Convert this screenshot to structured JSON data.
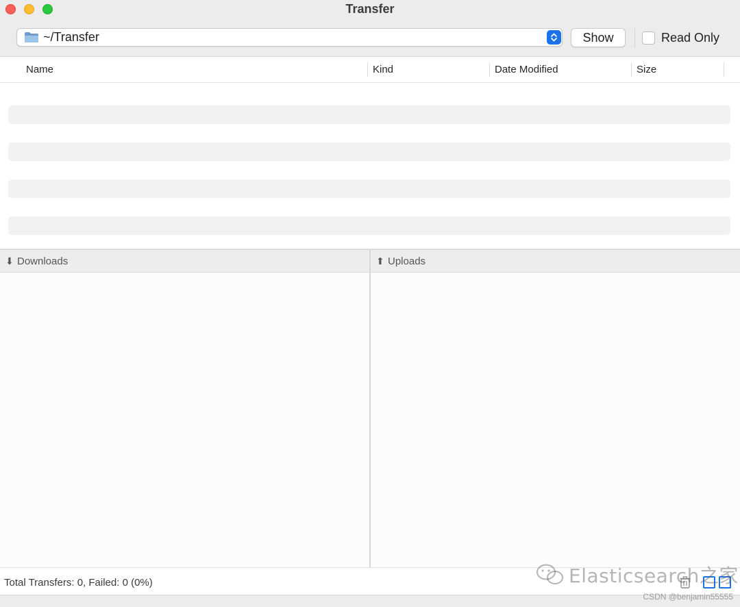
{
  "window": {
    "title": "Transfer"
  },
  "toolbar": {
    "path_value": "~/Transfer",
    "show_label": "Show",
    "read_only_label": "Read Only",
    "read_only_checked": false
  },
  "table": {
    "columns": [
      "Name",
      "Kind",
      "Date Modified",
      "Size"
    ]
  },
  "transfers": {
    "downloads_label": "Downloads",
    "uploads_label": "Uploads"
  },
  "status": {
    "summary": "Total Transfers: 0, Failed: 0 (0%)"
  },
  "watermark": {
    "text": "Elasticsearch之家",
    "credit": "CSDN @benjamin55555"
  },
  "colors": {
    "accent": "#1a73e8",
    "close": "#fe5f57",
    "minimize": "#febc2e",
    "maximize": "#28c840"
  }
}
